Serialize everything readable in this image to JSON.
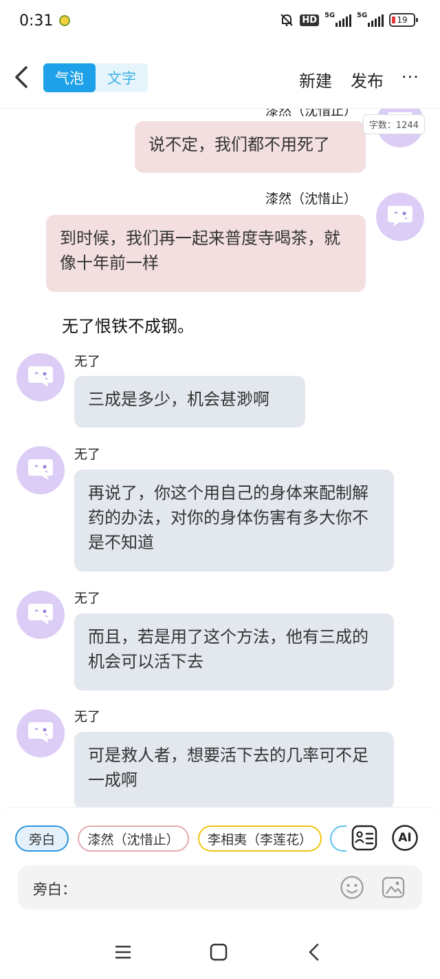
{
  "status_bar": {
    "time": "0:31",
    "network1": "5G",
    "network2": "5G",
    "hd": "HD",
    "battery": "19"
  },
  "header": {
    "tabs": [
      {
        "label": "气泡",
        "active": true
      },
      {
        "label": "文字",
        "active": false
      }
    ],
    "new_label": "新建",
    "publish_label": "发布",
    "more_label": "···"
  },
  "chat": {
    "top_partial_name": "漆然（沈惜止）",
    "word_count": "字数：1244",
    "messages": [
      {
        "type": "bubble",
        "side": "right",
        "speaker": "",
        "text": "说不定，我们都不用死了"
      },
      {
        "type": "bubble",
        "side": "right",
        "speaker": "漆然（沈惜止）",
        "text": "到时候，我们再一起来普度寺喝茶，就像十年前一样"
      },
      {
        "type": "narration",
        "text": "无了恨铁不成钢。"
      },
      {
        "type": "bubble",
        "side": "left",
        "speaker": "无了",
        "text": "三成是多少，机会甚渺啊"
      },
      {
        "type": "bubble",
        "side": "left",
        "speaker": "无了",
        "text": "再说了，你这个用自己的身体来配制解药的办法，对你的身体伤害有多大你不是不知道"
      },
      {
        "type": "bubble",
        "side": "left",
        "speaker": "无了",
        "text": "而且，若是用了这个方法，他有三成的机会可以活下去"
      },
      {
        "type": "bubble",
        "side": "left",
        "speaker": "无了",
        "text": "可是救人者，想要活下去的几率可不足一成啊"
      }
    ]
  },
  "bottom_panel": {
    "chips": [
      "旁白",
      "漆然（沈惜止）",
      "李相夷（李莲花）"
    ],
    "ai_label": "AI",
    "input_label": "旁白："
  },
  "colors": {
    "accent": "#1ea1e8",
    "right_bubble": "#f3dfe0",
    "left_bubble": "#e3e7ee",
    "avatar": "#dccdf6"
  }
}
